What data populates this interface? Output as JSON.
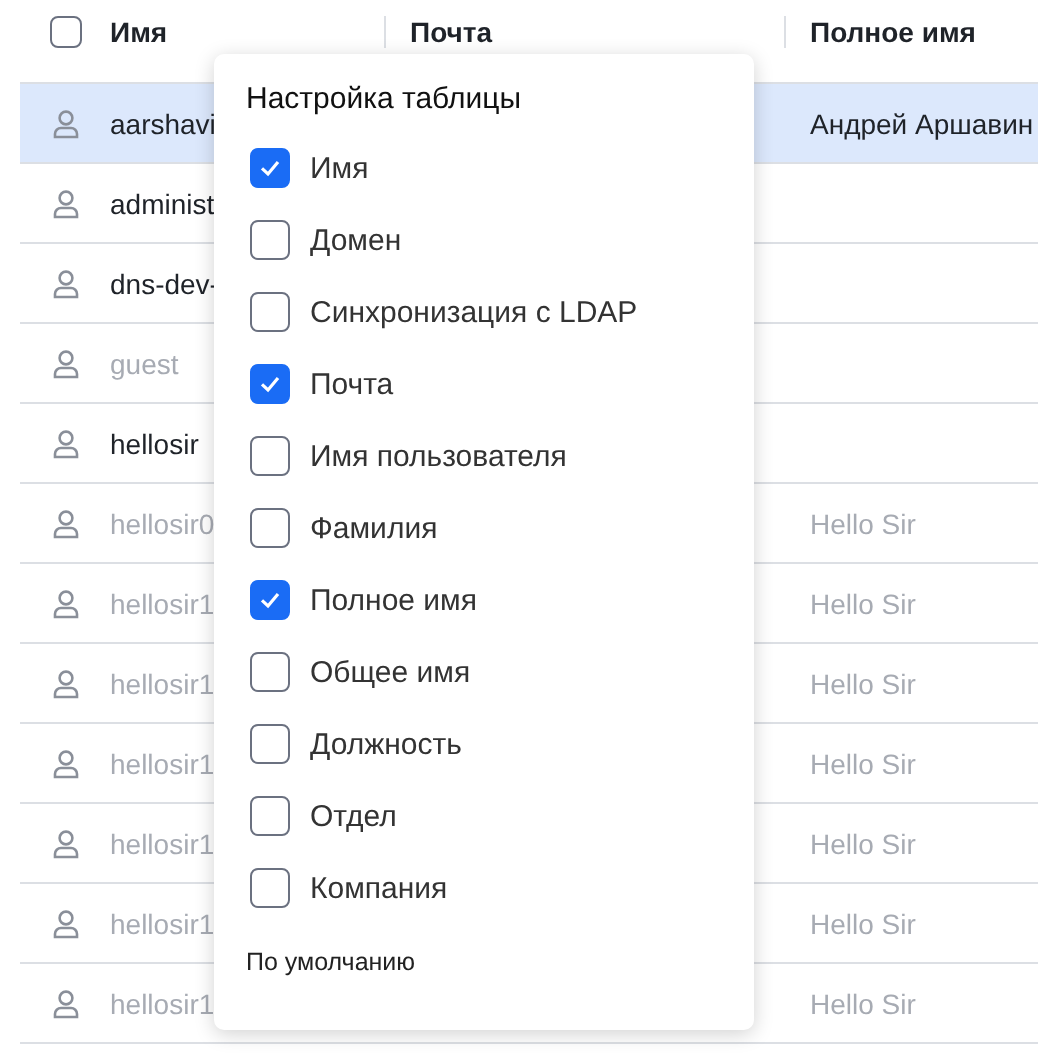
{
  "table": {
    "select_all": {
      "checked": false
    },
    "columns": [
      "Имя",
      "Почта",
      "Полное имя"
    ],
    "rows": [
      {
        "name": "aarshavi",
        "full_name": "Андрей Аршавин",
        "selected": true,
        "disabled": false
      },
      {
        "name": "administ",
        "selected": false,
        "disabled": false
      },
      {
        "name": "dns-dev-",
        "selected": false,
        "disabled": false
      },
      {
        "name": "guest",
        "selected": false,
        "disabled": true
      },
      {
        "name": "hellosir",
        "selected": false,
        "disabled": false
      },
      {
        "name": "hellosir0",
        "full_name": "Hello Sir",
        "selected": false,
        "disabled": true
      },
      {
        "name": "hellosir1",
        "full_name": "Hello Sir",
        "selected": false,
        "disabled": true
      },
      {
        "name": "hellosir1",
        "full_name": "Hello Sir",
        "selected": false,
        "disabled": true
      },
      {
        "name": "hellosir1",
        "full_name": "Hello Sir",
        "selected": false,
        "disabled": true
      },
      {
        "name": "hellosir1",
        "full_name": "Hello Sir",
        "selected": false,
        "disabled": true
      },
      {
        "name": "hellosir1",
        "full_name": "Hello Sir",
        "selected": false,
        "disabled": true
      },
      {
        "name": "hellosir1",
        "full_name": "Hello Sir",
        "selected": false,
        "disabled": true
      }
    ]
  },
  "column_settings": {
    "title": "Настройка таблицы",
    "options": [
      {
        "label": "Имя",
        "checked": true
      },
      {
        "label": "Домен",
        "checked": false
      },
      {
        "label": "Синхронизация с LDAP",
        "checked": false
      },
      {
        "label": "Почта",
        "checked": true
      },
      {
        "label": "Имя пользователя",
        "checked": false
      },
      {
        "label": "Фамилия",
        "checked": false
      },
      {
        "label": "Полное имя",
        "checked": true
      },
      {
        "label": "Общее имя",
        "checked": false
      },
      {
        "label": "Должность",
        "checked": false
      },
      {
        "label": "Отдел",
        "checked": false
      },
      {
        "label": "Компания",
        "checked": false
      }
    ],
    "reset_label": "По умолчанию"
  }
}
